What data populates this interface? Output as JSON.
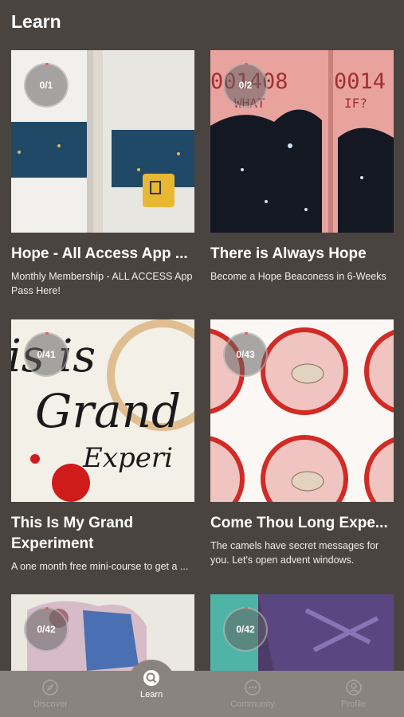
{
  "header": {
    "title": "Learn"
  },
  "cards": [
    {
      "progress": "0/1",
      "title": "Hope - All Access App ...",
      "desc": "Monthly Membership - ALL ACCESS App Pass Here!"
    },
    {
      "progress": "0/2",
      "title": "There is Always Hope",
      "desc": "Become a Hope Beaconess in 6-Weeks"
    },
    {
      "progress": "0/41",
      "title": "This Is My Grand Experiment",
      "desc": "A one month free mini-course to get a ..."
    },
    {
      "progress": "0/43",
      "title": "Come Thou Long Expe...",
      "desc": "The camels have secret messages for you. Let's open advent windows."
    },
    {
      "progress": "0/42",
      "title": "",
      "desc": ""
    },
    {
      "progress": "0/42",
      "title": "",
      "desc": ""
    }
  ],
  "thumb_text": {
    "ticket_left": "001408",
    "ticket_left_sub": "WHAT",
    "ticket_right": "0014",
    "ticket_right_sub": "IF?",
    "grand_line1": "is is",
    "grand_line2": "Grand",
    "grand_line3": "Experi"
  },
  "nav": [
    {
      "label": "Discover",
      "icon": "compass-icon",
      "active": false
    },
    {
      "label": "Learn",
      "icon": "search-icon",
      "active": true
    },
    {
      "label": "Community",
      "icon": "chat-icon",
      "active": false
    },
    {
      "label": "Profile",
      "icon": "user-icon",
      "active": false
    }
  ],
  "colors": {
    "background": "#4a4440",
    "nav": "#8a847e",
    "accent": "#e0605a"
  }
}
